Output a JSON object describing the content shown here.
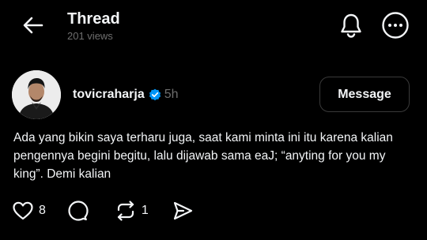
{
  "header": {
    "title": "Thread",
    "views": "201 views",
    "back_icon": "arrow-left-icon",
    "bell_icon": "bell-icon",
    "more_icon": "more-horizontal-icon"
  },
  "post": {
    "author": {
      "username": "tovicraharja",
      "verified_icon": "verified-badge-icon",
      "verified_color": "#0095f6",
      "timestamp": "5h"
    },
    "message_button_label": "Message",
    "text": "Ada yang bikin saya terharu juga, saat kami minta ini itu karena kalian pengennya begini begitu, lalu dijawab sama eaJ; “anyting for you my king”. Demi kalian",
    "actions": {
      "like_count": "8",
      "repost_count": "1"
    }
  },
  "colors": {
    "background": "#000000",
    "text": "#f3f5f7",
    "muted": "#6e6e6e",
    "border": "#3a3a3a"
  }
}
